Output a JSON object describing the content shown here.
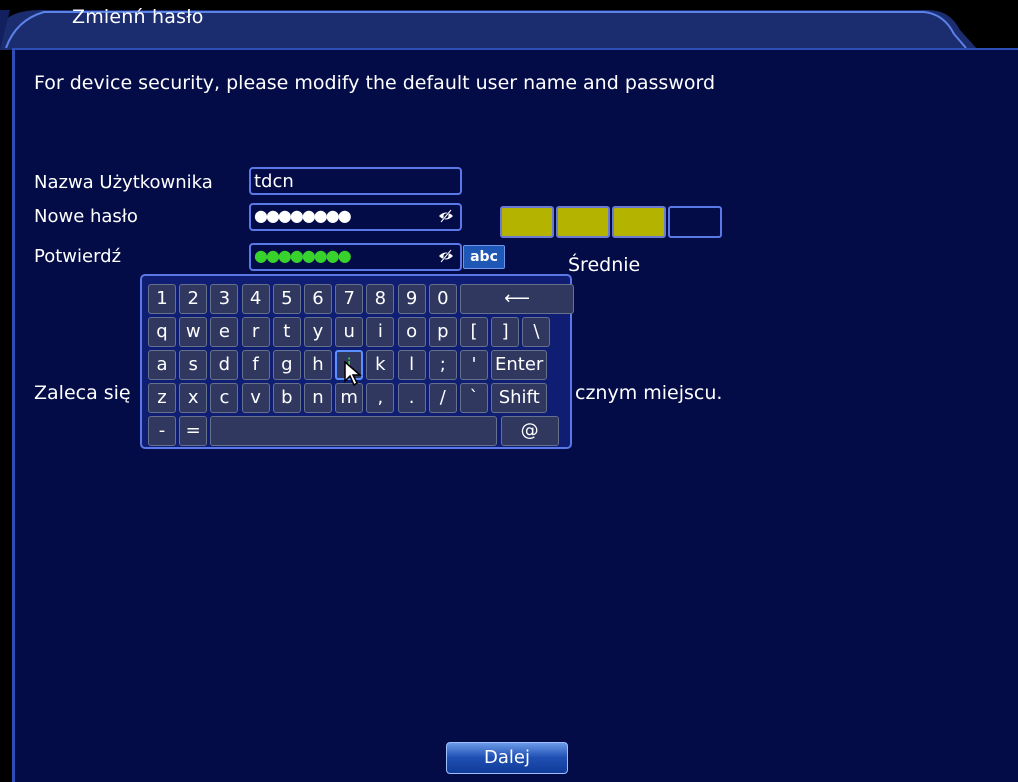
{
  "window": {
    "title": "Zmienń hasło"
  },
  "notice": "For device security, please modify the default user name and password",
  "form": {
    "username_label": "Nazwa Użytkownika",
    "username_value": "tdcn",
    "new_password_label": "Nowe hasło",
    "new_password_mask": "●●●●●●●●",
    "confirm_label": "Potwierdź",
    "confirm_mask": "●●●●●●●●"
  },
  "strength": {
    "level": 3,
    "max": 4,
    "label": "Średnie",
    "color": "#b3b300"
  },
  "abc_label": "abc",
  "keyboard": {
    "rows": [
      [
        "1",
        "2",
        "3",
        "4",
        "5",
        "6",
        "7",
        "8",
        "9",
        "0",
        "⟵"
      ],
      [
        "q",
        "w",
        "e",
        "r",
        "t",
        "y",
        "u",
        "i",
        "o",
        "p",
        "[",
        "]",
        "\\"
      ],
      [
        "a",
        "s",
        "d",
        "f",
        "g",
        "h",
        "j",
        "k",
        "l",
        ";",
        "'",
        "Enter"
      ],
      [
        "z",
        "x",
        "c",
        "v",
        "b",
        "n",
        "m",
        ",",
        ".",
        "/",
        "`",
        "Shift"
      ],
      [
        "-",
        "=",
        "",
        "@"
      ]
    ],
    "active_key": "j"
  },
  "tip": {
    "left": "Zaleca się",
    "right": "cznym miejscu."
  },
  "next_button": "Dalej",
  "colors": {
    "panel": "#030c47",
    "accent": "#5a78e6",
    "active_key": "#38d22c"
  }
}
